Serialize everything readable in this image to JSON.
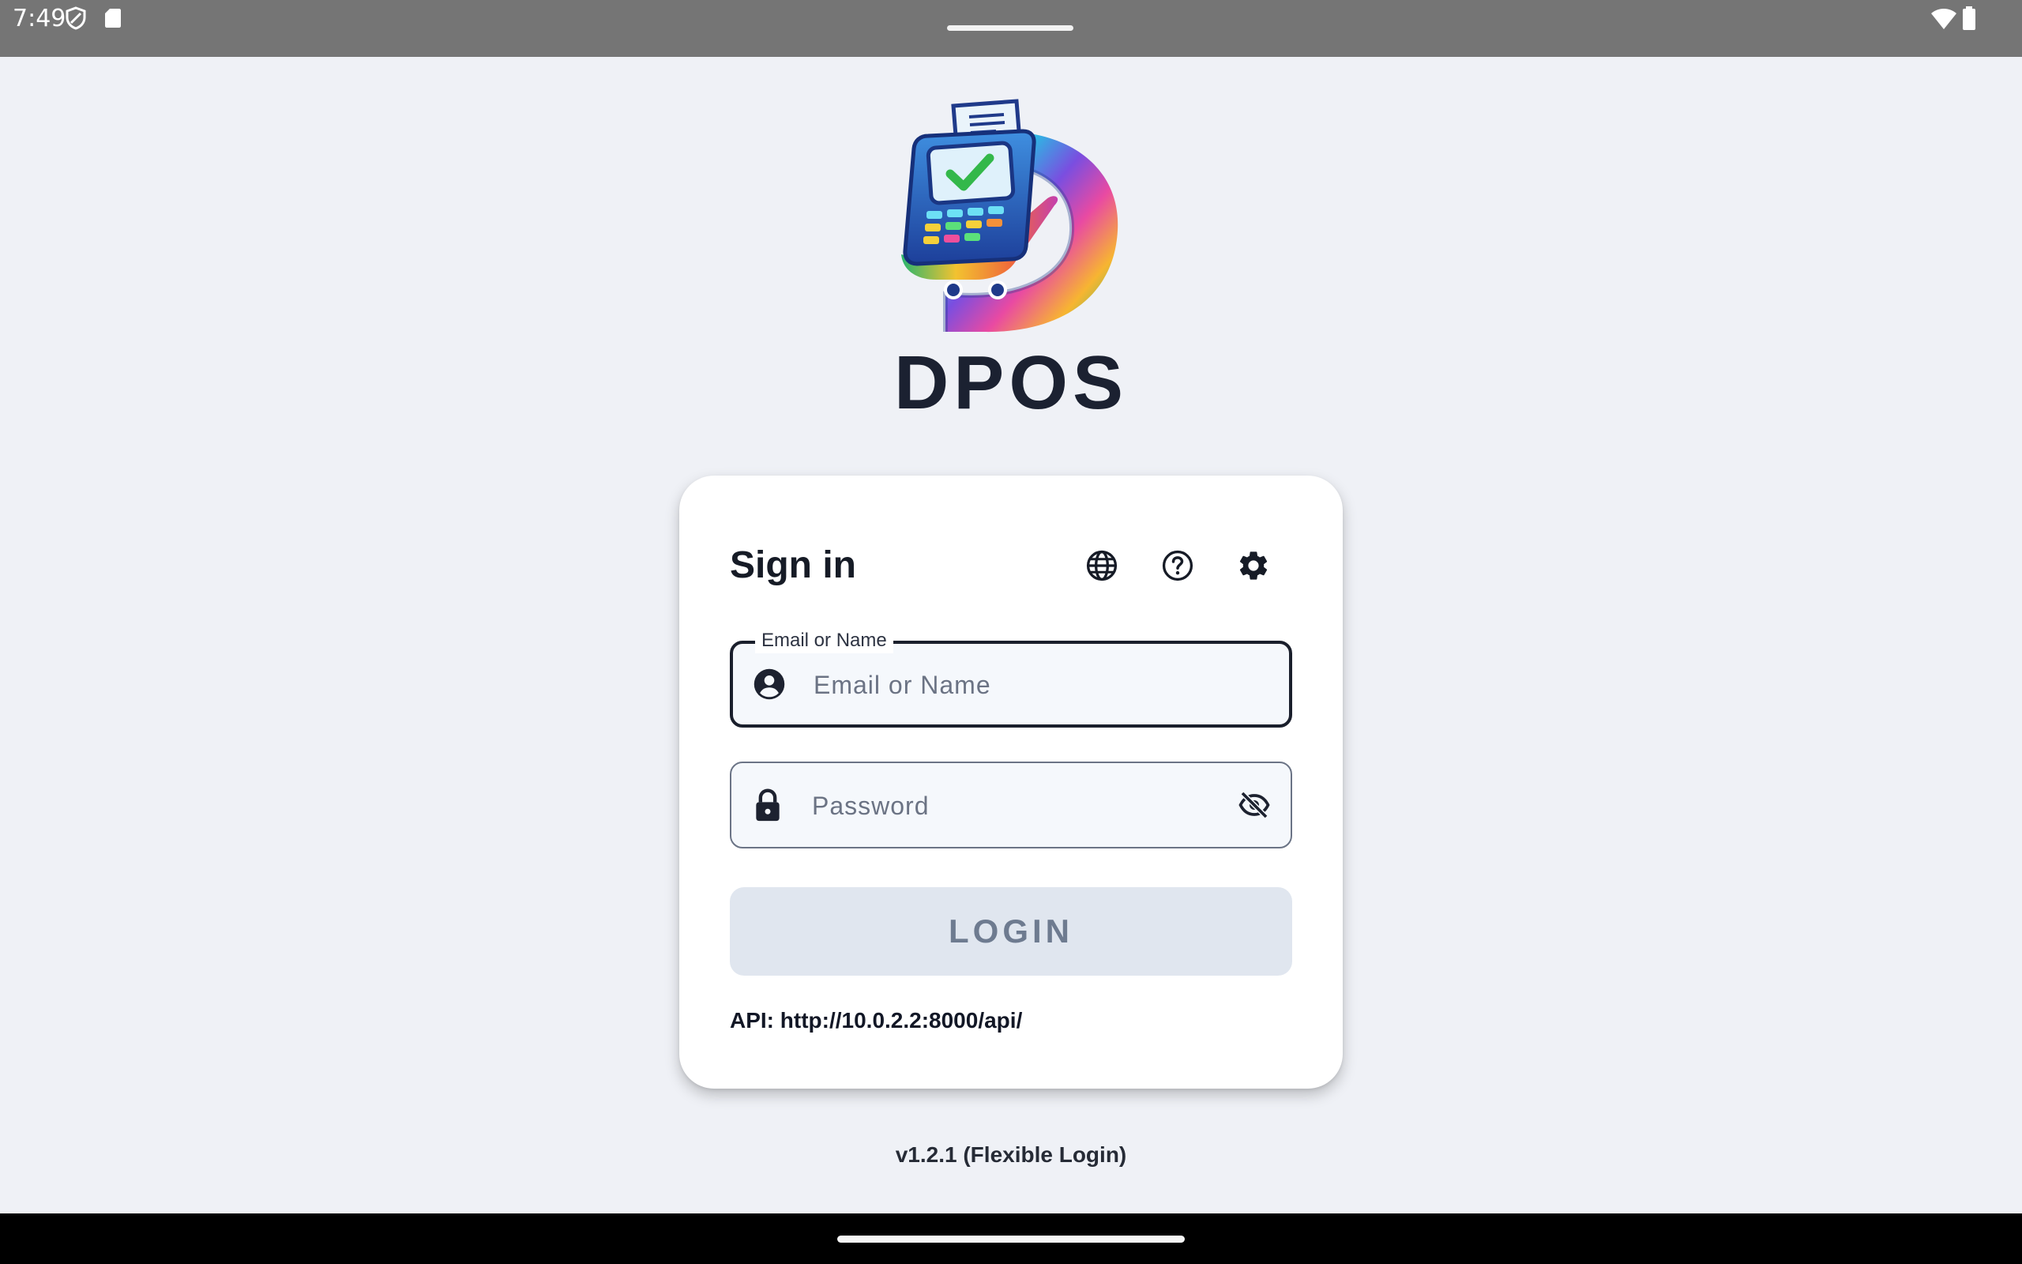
{
  "status_bar": {
    "time": "7:49"
  },
  "app": {
    "name": "DPOS",
    "version": "v1.2.1 (Flexible Login)"
  },
  "signin": {
    "title": "Sign in",
    "header_icons": [
      "globe-icon",
      "help-icon",
      "settings-gear-icon"
    ],
    "username_field": {
      "label": "Email or Name",
      "placeholder": "Email or Name",
      "value": ""
    },
    "password_field": {
      "placeholder": "Password",
      "value": ""
    },
    "login_button": "LOGIN",
    "api_text": "API: http://10.0.2.2:8000/api/"
  },
  "colors": {
    "background": "#eff1f6",
    "card": "#ffffff",
    "login_button_bg": "#e0e6ef",
    "login_button_text": "#6e7b90",
    "status_bar": "#757575"
  }
}
